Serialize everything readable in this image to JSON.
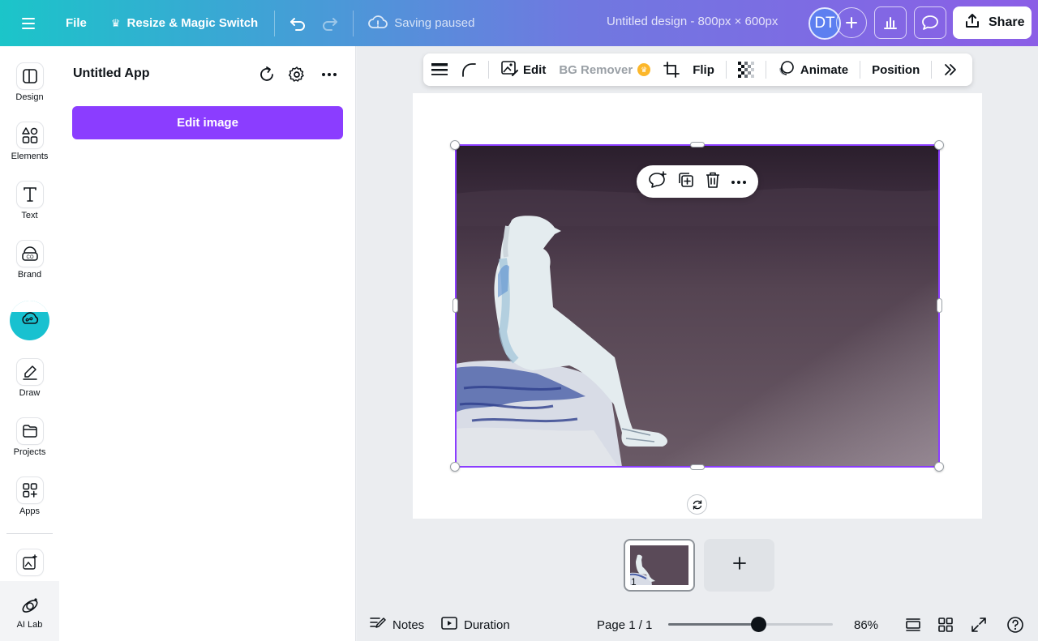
{
  "topbar": {
    "menu_icon": "hamburger-icon",
    "file_label": "File",
    "resize_label": "Resize & Magic Switch",
    "saving_status": "Saving paused",
    "design_title": "Untitled design - 800px × 600px",
    "avatar_initials": "DT",
    "share_label": "Share"
  },
  "rail": {
    "items": [
      {
        "label": "Design",
        "icon": "design-icon"
      },
      {
        "label": "Elements",
        "icon": "elements-icon"
      },
      {
        "label": "Text",
        "icon": "text-icon"
      },
      {
        "label": "Brand",
        "icon": "brand-icon"
      },
      {
        "label": "Draw",
        "icon": "draw-icon"
      },
      {
        "label": "Projects",
        "icon": "projects-icon"
      },
      {
        "label": "Apps",
        "icon": "apps-icon"
      }
    ],
    "ai_lab_label": "AI Lab"
  },
  "panel": {
    "title": "Untitled App",
    "edit_button": "Edit image"
  },
  "toolbar": {
    "edit_label": "Edit",
    "bg_remover_label": "BG Remover",
    "flip_label": "Flip",
    "animate_label": "Animate",
    "position_label": "Position"
  },
  "pages": {
    "current_number": "1"
  },
  "footer": {
    "notes_label": "Notes",
    "duration_label": "Duration",
    "page_indicator": "Page 1 / 1",
    "zoom_label": "86%",
    "zoom_fraction": 0.55
  },
  "colors": {
    "accent": "#8b3dff",
    "teal": "#18c1d0"
  }
}
